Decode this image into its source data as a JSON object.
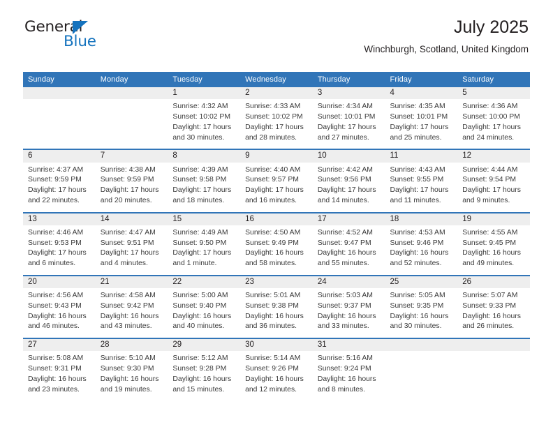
{
  "brand": {
    "name_part1": "General",
    "name_part2": "Blue",
    "triangle_color": "#1573be"
  },
  "header": {
    "title": "July 2025",
    "subtitle": "Winchburgh, Scotland, United Kingdom",
    "accent_color": "#3175b8",
    "date_band_color": "#eeeeee"
  },
  "weekday_headers": [
    "Sunday",
    "Monday",
    "Tuesday",
    "Wednesday",
    "Thursday",
    "Friday",
    "Saturday"
  ],
  "labels": {
    "sunrise": "Sunrise:",
    "sunset": "Sunset:",
    "daylight": "Daylight:"
  },
  "weeks": [
    {
      "days": [
        {
          "date": "",
          "sunrise": "",
          "sunset": "",
          "daylight_line1": "",
          "daylight_line2": ""
        },
        {
          "date": "",
          "sunrise": "",
          "sunset": "",
          "daylight_line1": "",
          "daylight_line2": ""
        },
        {
          "date": "1",
          "sunrise": "Sunrise: 4:32 AM",
          "sunset": "Sunset: 10:02 PM",
          "daylight_line1": "Daylight: 17 hours",
          "daylight_line2": "and 30 minutes."
        },
        {
          "date": "2",
          "sunrise": "Sunrise: 4:33 AM",
          "sunset": "Sunset: 10:02 PM",
          "daylight_line1": "Daylight: 17 hours",
          "daylight_line2": "and 28 minutes."
        },
        {
          "date": "3",
          "sunrise": "Sunrise: 4:34 AM",
          "sunset": "Sunset: 10:01 PM",
          "daylight_line1": "Daylight: 17 hours",
          "daylight_line2": "and 27 minutes."
        },
        {
          "date": "4",
          "sunrise": "Sunrise: 4:35 AM",
          "sunset": "Sunset: 10:01 PM",
          "daylight_line1": "Daylight: 17 hours",
          "daylight_line2": "and 25 minutes."
        },
        {
          "date": "5",
          "sunrise": "Sunrise: 4:36 AM",
          "sunset": "Sunset: 10:00 PM",
          "daylight_line1": "Daylight: 17 hours",
          "daylight_line2": "and 24 minutes."
        }
      ]
    },
    {
      "days": [
        {
          "date": "6",
          "sunrise": "Sunrise: 4:37 AM",
          "sunset": "Sunset: 9:59 PM",
          "daylight_line1": "Daylight: 17 hours",
          "daylight_line2": "and 22 minutes."
        },
        {
          "date": "7",
          "sunrise": "Sunrise: 4:38 AM",
          "sunset": "Sunset: 9:59 PM",
          "daylight_line1": "Daylight: 17 hours",
          "daylight_line2": "and 20 minutes."
        },
        {
          "date": "8",
          "sunrise": "Sunrise: 4:39 AM",
          "sunset": "Sunset: 9:58 PM",
          "daylight_line1": "Daylight: 17 hours",
          "daylight_line2": "and 18 minutes."
        },
        {
          "date": "9",
          "sunrise": "Sunrise: 4:40 AM",
          "sunset": "Sunset: 9:57 PM",
          "daylight_line1": "Daylight: 17 hours",
          "daylight_line2": "and 16 minutes."
        },
        {
          "date": "10",
          "sunrise": "Sunrise: 4:42 AM",
          "sunset": "Sunset: 9:56 PM",
          "daylight_line1": "Daylight: 17 hours",
          "daylight_line2": "and 14 minutes."
        },
        {
          "date": "11",
          "sunrise": "Sunrise: 4:43 AM",
          "sunset": "Sunset: 9:55 PM",
          "daylight_line1": "Daylight: 17 hours",
          "daylight_line2": "and 11 minutes."
        },
        {
          "date": "12",
          "sunrise": "Sunrise: 4:44 AM",
          "sunset": "Sunset: 9:54 PM",
          "daylight_line1": "Daylight: 17 hours",
          "daylight_line2": "and 9 minutes."
        }
      ]
    },
    {
      "days": [
        {
          "date": "13",
          "sunrise": "Sunrise: 4:46 AM",
          "sunset": "Sunset: 9:53 PM",
          "daylight_line1": "Daylight: 17 hours",
          "daylight_line2": "and 6 minutes."
        },
        {
          "date": "14",
          "sunrise": "Sunrise: 4:47 AM",
          "sunset": "Sunset: 9:51 PM",
          "daylight_line1": "Daylight: 17 hours",
          "daylight_line2": "and 4 minutes."
        },
        {
          "date": "15",
          "sunrise": "Sunrise: 4:49 AM",
          "sunset": "Sunset: 9:50 PM",
          "daylight_line1": "Daylight: 17 hours",
          "daylight_line2": "and 1 minute."
        },
        {
          "date": "16",
          "sunrise": "Sunrise: 4:50 AM",
          "sunset": "Sunset: 9:49 PM",
          "daylight_line1": "Daylight: 16 hours",
          "daylight_line2": "and 58 minutes."
        },
        {
          "date": "17",
          "sunrise": "Sunrise: 4:52 AM",
          "sunset": "Sunset: 9:47 PM",
          "daylight_line1": "Daylight: 16 hours",
          "daylight_line2": "and 55 minutes."
        },
        {
          "date": "18",
          "sunrise": "Sunrise: 4:53 AM",
          "sunset": "Sunset: 9:46 PM",
          "daylight_line1": "Daylight: 16 hours",
          "daylight_line2": "and 52 minutes."
        },
        {
          "date": "19",
          "sunrise": "Sunrise: 4:55 AM",
          "sunset": "Sunset: 9:45 PM",
          "daylight_line1": "Daylight: 16 hours",
          "daylight_line2": "and 49 minutes."
        }
      ]
    },
    {
      "days": [
        {
          "date": "20",
          "sunrise": "Sunrise: 4:56 AM",
          "sunset": "Sunset: 9:43 PM",
          "daylight_line1": "Daylight: 16 hours",
          "daylight_line2": "and 46 minutes."
        },
        {
          "date": "21",
          "sunrise": "Sunrise: 4:58 AM",
          "sunset": "Sunset: 9:42 PM",
          "daylight_line1": "Daylight: 16 hours",
          "daylight_line2": "and 43 minutes."
        },
        {
          "date": "22",
          "sunrise": "Sunrise: 5:00 AM",
          "sunset": "Sunset: 9:40 PM",
          "daylight_line1": "Daylight: 16 hours",
          "daylight_line2": "and 40 minutes."
        },
        {
          "date": "23",
          "sunrise": "Sunrise: 5:01 AM",
          "sunset": "Sunset: 9:38 PM",
          "daylight_line1": "Daylight: 16 hours",
          "daylight_line2": "and 36 minutes."
        },
        {
          "date": "24",
          "sunrise": "Sunrise: 5:03 AM",
          "sunset": "Sunset: 9:37 PM",
          "daylight_line1": "Daylight: 16 hours",
          "daylight_line2": "and 33 minutes."
        },
        {
          "date": "25",
          "sunrise": "Sunrise: 5:05 AM",
          "sunset": "Sunset: 9:35 PM",
          "daylight_line1": "Daylight: 16 hours",
          "daylight_line2": "and 30 minutes."
        },
        {
          "date": "26",
          "sunrise": "Sunrise: 5:07 AM",
          "sunset": "Sunset: 9:33 PM",
          "daylight_line1": "Daylight: 16 hours",
          "daylight_line2": "and 26 minutes."
        }
      ]
    },
    {
      "days": [
        {
          "date": "27",
          "sunrise": "Sunrise: 5:08 AM",
          "sunset": "Sunset: 9:31 PM",
          "daylight_line1": "Daylight: 16 hours",
          "daylight_line2": "and 23 minutes."
        },
        {
          "date": "28",
          "sunrise": "Sunrise: 5:10 AM",
          "sunset": "Sunset: 9:30 PM",
          "daylight_line1": "Daylight: 16 hours",
          "daylight_line2": "and 19 minutes."
        },
        {
          "date": "29",
          "sunrise": "Sunrise: 5:12 AM",
          "sunset": "Sunset: 9:28 PM",
          "daylight_line1": "Daylight: 16 hours",
          "daylight_line2": "and 15 minutes."
        },
        {
          "date": "30",
          "sunrise": "Sunrise: 5:14 AM",
          "sunset": "Sunset: 9:26 PM",
          "daylight_line1": "Daylight: 16 hours",
          "daylight_line2": "and 12 minutes."
        },
        {
          "date": "31",
          "sunrise": "Sunrise: 5:16 AM",
          "sunset": "Sunset: 9:24 PM",
          "daylight_line1": "Daylight: 16 hours",
          "daylight_line2": "and 8 minutes."
        },
        {
          "date": "",
          "sunrise": "",
          "sunset": "",
          "daylight_line1": "",
          "daylight_line2": ""
        },
        {
          "date": "",
          "sunrise": "",
          "sunset": "",
          "daylight_line1": "",
          "daylight_line2": ""
        }
      ]
    }
  ]
}
